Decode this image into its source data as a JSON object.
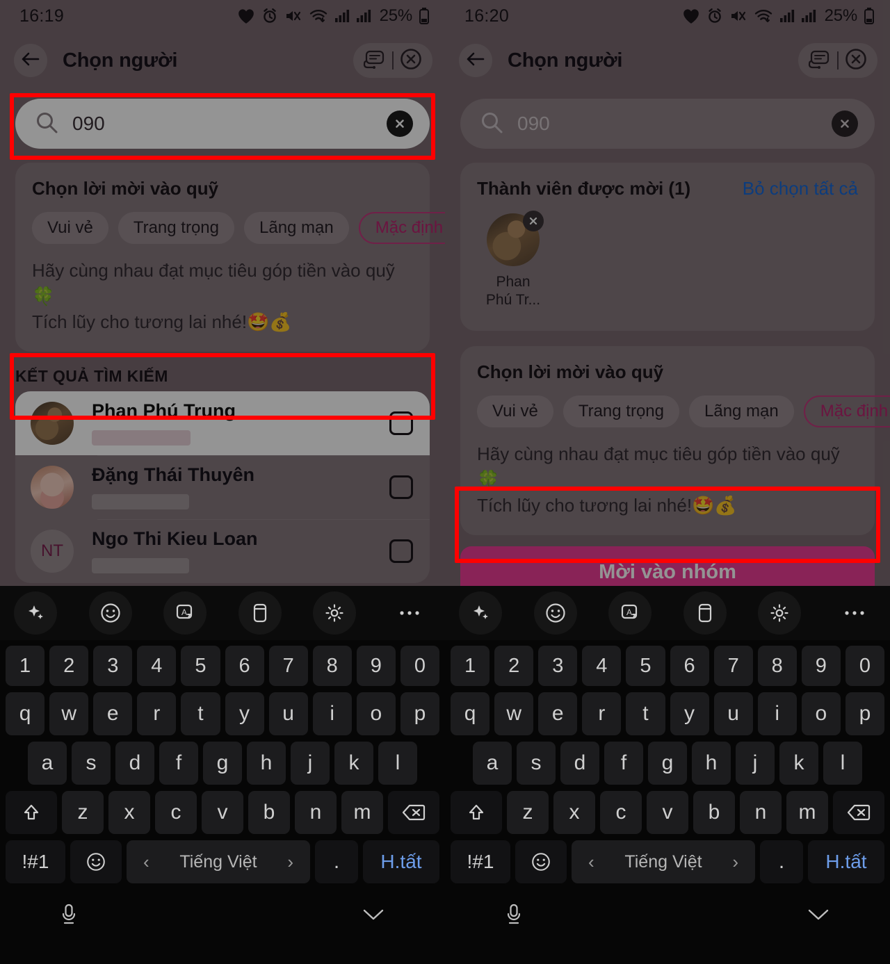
{
  "panels": [
    {
      "status": {
        "time": "16:19",
        "battery": "25%"
      },
      "header": {
        "title": "Chọn người",
        "back_icon": "arrow-left-icon",
        "support_icon": "headset-icon",
        "close_icon": "close-circle-icon"
      },
      "search": {
        "value": "090",
        "search_icon": "search-icon",
        "clear_icon": "clear-icon"
      },
      "invite_card": {
        "title": "Chọn lời mời vào quỹ",
        "chips": [
          {
            "label": "Vui vẻ",
            "selected": false
          },
          {
            "label": "Trang trọng",
            "selected": false
          },
          {
            "label": "Lãng mạn",
            "selected": false
          },
          {
            "label": "Mặc định",
            "selected": true
          }
        ],
        "message_line1": "Hãy cùng nhau đạt mục tiêu góp tiền vào quỹ 🍀",
        "message_line2": "Tích lũy cho tương lai nhé!🤩💰"
      },
      "results_label": "KẾT QUẢ TÌM KIẾM",
      "results": [
        {
          "name": "Phan Phú Trung",
          "avatar": "cat-photo",
          "initials": "",
          "checked": false,
          "highlighted": true
        },
        {
          "name": "Đặng Thái Thuyên",
          "avatar": "baby-photo",
          "initials": "",
          "checked": false,
          "highlighted": false
        },
        {
          "name": "Ngo Thi Kieu Loan",
          "avatar": "initials",
          "initials": "NT",
          "checked": false,
          "highlighted": false
        }
      ]
    },
    {
      "status": {
        "time": "16:20",
        "battery": "25%"
      },
      "header": {
        "title": "Chọn người",
        "back_icon": "arrow-left-icon",
        "support_icon": "headset-icon",
        "close_icon": "close-circle-icon"
      },
      "search": {
        "value": "090",
        "search_icon": "search-icon",
        "clear_icon": "clear-icon"
      },
      "selected_card": {
        "title": "Thành viên được mời (1)",
        "deselect_all": "Bỏ chọn tất cả",
        "members": [
          {
            "name_line1": "Phan",
            "name_line2": "Phú Tr...",
            "avatar": "cat-photo",
            "remove_icon": "remove-icon"
          }
        ]
      },
      "invite_card": {
        "title": "Chọn lời mời vào quỹ",
        "chips": [
          {
            "label": "Vui vẻ",
            "selected": false
          },
          {
            "label": "Trang trọng",
            "selected": false
          },
          {
            "label": "Lãng mạn",
            "selected": false
          },
          {
            "label": "Mặc định",
            "selected": true
          }
        ],
        "message_line1": "Hãy cùng nhau đạt mục tiêu góp tiền vào quỹ 🍀",
        "message_line2": "Tích lũy cho tương lai nhé!🤩💰"
      },
      "primary_button": "Mời vào nhóm"
    }
  ],
  "keyboard": {
    "toolbar_icons": [
      "sparkle-icon",
      "emoji-icon",
      "translate-icon",
      "clipboard-icon",
      "settings-icon",
      "more-icon"
    ],
    "row_numbers": [
      "1",
      "2",
      "3",
      "4",
      "5",
      "6",
      "7",
      "8",
      "9",
      "0"
    ],
    "row_top": [
      "q",
      "w",
      "e",
      "r",
      "t",
      "y",
      "u",
      "i",
      "o",
      "p"
    ],
    "row_home": [
      "a",
      "s",
      "d",
      "f",
      "g",
      "h",
      "j",
      "k",
      "l"
    ],
    "row_bottom": [
      "z",
      "x",
      "c",
      "v",
      "b",
      "n",
      "m"
    ],
    "shift_icon": "shift-icon",
    "backspace_icon": "backspace-icon",
    "symbols_key": "!#1",
    "emoji_key_icon": "emoji-icon",
    "space_label": "Tiếng Việt",
    "space_prev": "‹",
    "space_next": "›",
    "period_key": ".",
    "done_key": "H.tất",
    "mic_icon": "microphone-icon",
    "hide_icon": "chevron-down-icon"
  },
  "colors": {
    "accent_pink": "#ed3d96",
    "chip_selected": "#b8246f",
    "link_blue": "#1668d8",
    "annotation_red": "#ff0000"
  }
}
